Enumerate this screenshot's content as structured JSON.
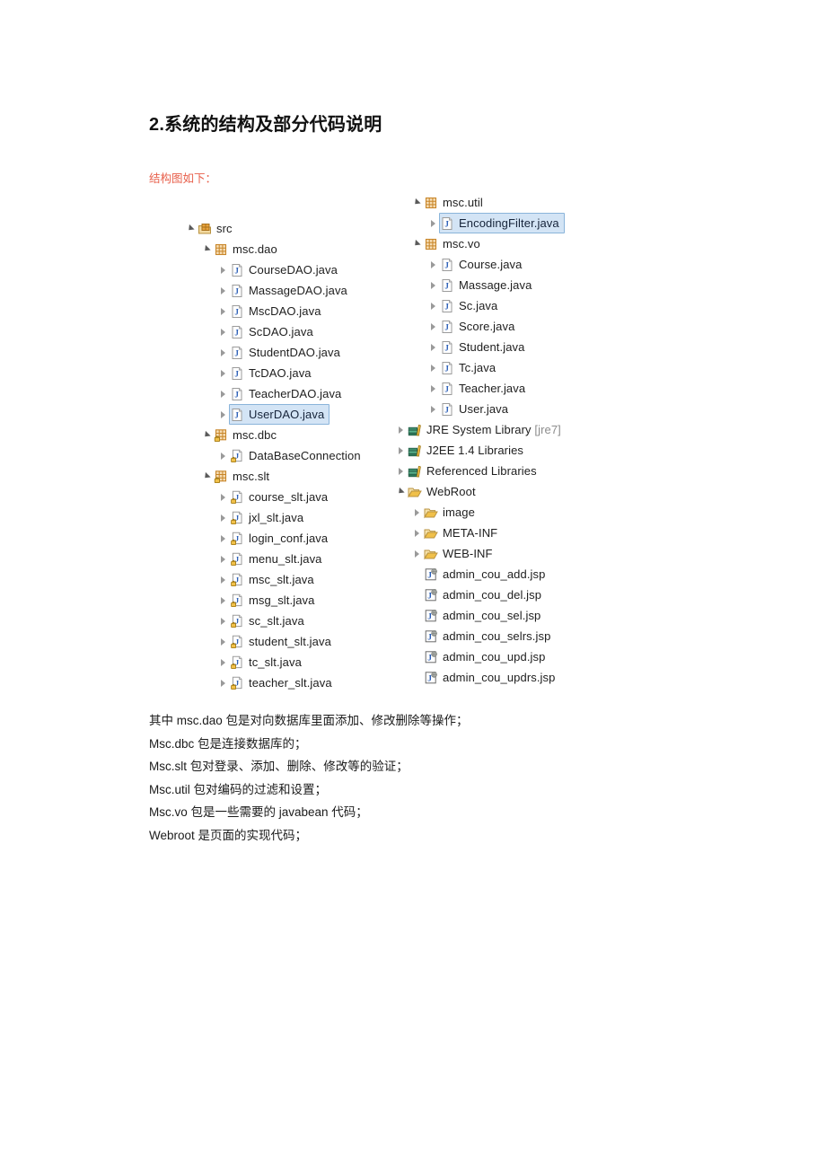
{
  "document": {
    "title": "2.系统的结构及部分代码说明",
    "subtitle": "结构图如下："
  },
  "colors": {
    "subtitle_red": "#e8604c",
    "selection_fill": "#d3e4f5",
    "selection_border": "#8ab4da",
    "package_icon": "#e8a33d",
    "folder_icon": "#f0c04a",
    "java_icon_letter": "#2b5fb8",
    "library_icon": "#3f8f6f",
    "dim_text": "#8d8d8d"
  },
  "tree_left": [
    {
      "label": "src",
      "icon": "source-folder-icon",
      "indent": 0,
      "arrow": "open",
      "selected": false
    },
    {
      "label": "msc.dao",
      "icon": "package-icon",
      "indent": 1,
      "arrow": "open",
      "selected": false
    },
    {
      "label": "CourseDAO.java",
      "icon": "java-file-icon",
      "indent": 2,
      "arrow": "closed",
      "selected": false
    },
    {
      "label": "MassageDAO.java",
      "icon": "java-file-icon",
      "indent": 2,
      "arrow": "closed",
      "selected": false
    },
    {
      "label": "MscDAO.java",
      "icon": "java-file-icon",
      "indent": 2,
      "arrow": "closed",
      "selected": false
    },
    {
      "label": "ScDAO.java",
      "icon": "java-file-icon",
      "indent": 2,
      "arrow": "closed",
      "selected": false
    },
    {
      "label": "StudentDAO.java",
      "icon": "java-file-icon",
      "indent": 2,
      "arrow": "closed",
      "selected": false
    },
    {
      "label": "TcDAO.java",
      "icon": "java-file-icon",
      "indent": 2,
      "arrow": "closed",
      "selected": false
    },
    {
      "label": "TeacherDAO.java",
      "icon": "java-file-icon",
      "indent": 2,
      "arrow": "closed",
      "selected": false
    },
    {
      "label": "UserDAO.java",
      "icon": "java-file-icon",
      "indent": 2,
      "arrow": "closed",
      "selected": true
    },
    {
      "label": "msc.dbc",
      "icon": "package-locked-icon",
      "indent": 1,
      "arrow": "open",
      "selected": false
    },
    {
      "label": "DataBaseConnection",
      "icon": "java-locked-icon",
      "indent": 2,
      "arrow": "closed",
      "selected": false,
      "clipped": true
    },
    {
      "label": "msc.slt",
      "icon": "package-locked-icon",
      "indent": 1,
      "arrow": "open",
      "selected": false
    },
    {
      "label": "course_slt.java",
      "icon": "java-locked-icon",
      "indent": 2,
      "arrow": "closed",
      "selected": false
    },
    {
      "label": "jxl_slt.java",
      "icon": "java-locked-icon",
      "indent": 2,
      "arrow": "closed",
      "selected": false
    },
    {
      "label": "login_conf.java",
      "icon": "java-locked-icon",
      "indent": 2,
      "arrow": "closed",
      "selected": false
    },
    {
      "label": "menu_slt.java",
      "icon": "java-locked-icon",
      "indent": 2,
      "arrow": "closed",
      "selected": false
    },
    {
      "label": "msc_slt.java",
      "icon": "java-locked-icon",
      "indent": 2,
      "arrow": "closed",
      "selected": false
    },
    {
      "label": "msg_slt.java",
      "icon": "java-locked-icon",
      "indent": 2,
      "arrow": "closed",
      "selected": false
    },
    {
      "label": "sc_slt.java",
      "icon": "java-locked-icon",
      "indent": 2,
      "arrow": "closed",
      "selected": false
    },
    {
      "label": "student_slt.java",
      "icon": "java-locked-icon",
      "indent": 2,
      "arrow": "closed",
      "selected": false
    },
    {
      "label": "tc_slt.java",
      "icon": "java-locked-icon",
      "indent": 2,
      "arrow": "closed",
      "selected": false
    },
    {
      "label": "teacher_slt.java",
      "icon": "java-locked-icon",
      "indent": 2,
      "arrow": "closed",
      "selected": false
    }
  ],
  "tree_right": [
    {
      "label": "msc.util",
      "icon": "package-icon",
      "indent": 1,
      "arrow": "open",
      "selected": false
    },
    {
      "label": "EncodingFilter.java",
      "icon": "java-file-icon",
      "indent": 2,
      "arrow": "closed",
      "selected": true
    },
    {
      "label": "msc.vo",
      "icon": "package-icon",
      "indent": 1,
      "arrow": "open",
      "selected": false
    },
    {
      "label": "Course.java",
      "icon": "java-file-icon",
      "indent": 2,
      "arrow": "closed",
      "selected": false
    },
    {
      "label": "Massage.java",
      "icon": "java-file-icon",
      "indent": 2,
      "arrow": "closed",
      "selected": false
    },
    {
      "label": "Sc.java",
      "icon": "java-file-icon",
      "indent": 2,
      "arrow": "closed",
      "selected": false
    },
    {
      "label": "Score.java",
      "icon": "java-file-icon",
      "indent": 2,
      "arrow": "closed",
      "selected": false
    },
    {
      "label": "Student.java",
      "icon": "java-file-icon",
      "indent": 2,
      "arrow": "closed",
      "selected": false
    },
    {
      "label": "Tc.java",
      "icon": "java-file-icon",
      "indent": 2,
      "arrow": "closed",
      "selected": false
    },
    {
      "label": "Teacher.java",
      "icon": "java-file-icon",
      "indent": 2,
      "arrow": "closed",
      "selected": false
    },
    {
      "label": "User.java",
      "icon": "java-file-icon",
      "indent": 2,
      "arrow": "closed",
      "selected": false
    },
    {
      "label": "JRE System Library",
      "suffix": "[jre7]",
      "icon": "library-icon",
      "indent": 0,
      "arrow": "closed",
      "selected": false
    },
    {
      "label": "J2EE 1.4 Libraries",
      "icon": "library-icon",
      "indent": 0,
      "arrow": "closed",
      "selected": false
    },
    {
      "label": "Referenced Libraries",
      "icon": "library-icon",
      "indent": 0,
      "arrow": "closed",
      "selected": false
    },
    {
      "label": "WebRoot",
      "icon": "folder-icon",
      "indent": 0,
      "arrow": "open",
      "selected": false
    },
    {
      "label": "image",
      "icon": "folder-icon",
      "indent": 1,
      "arrow": "closed",
      "selected": false
    },
    {
      "label": "META-INF",
      "icon": "folder-icon",
      "indent": 1,
      "arrow": "closed",
      "selected": false
    },
    {
      "label": "WEB-INF",
      "icon": "folder-icon",
      "indent": 1,
      "arrow": "closed",
      "selected": false
    },
    {
      "label": "admin_cou_add.jsp",
      "icon": "jsp-file-icon",
      "indent": 1,
      "arrow": "none",
      "selected": false
    },
    {
      "label": "admin_cou_del.jsp",
      "icon": "jsp-file-icon",
      "indent": 1,
      "arrow": "none",
      "selected": false
    },
    {
      "label": "admin_cou_sel.jsp",
      "icon": "jsp-file-icon",
      "indent": 1,
      "arrow": "none",
      "selected": false
    },
    {
      "label": "admin_cou_selrs.jsp",
      "icon": "jsp-file-icon",
      "indent": 1,
      "arrow": "none",
      "selected": false
    },
    {
      "label": "admin_cou_upd.jsp",
      "icon": "jsp-file-icon",
      "indent": 1,
      "arrow": "none",
      "selected": false
    },
    {
      "label": "admin_cou_updrs.jsp",
      "icon": "jsp-file-icon",
      "indent": 1,
      "arrow": "none",
      "selected": false
    }
  ],
  "description_lines": [
    "其中 msc.dao 包是对向数据库里面添加、修改删除等操作；",
    "Msc.dbc 包是连接数据库的；",
    "Msc.slt 包对登录、添加、删除、修改等的验证；",
    "Msc.util 包对编码的过滤和设置；",
    "Msc.vo 包是一些需要的 javabean 代码；",
    "Webroot 是页面的实现代码；"
  ]
}
